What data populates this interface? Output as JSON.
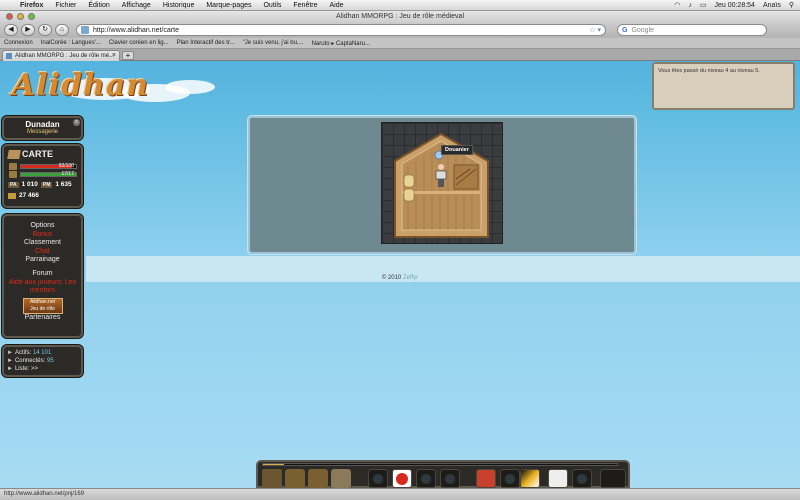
{
  "os_menubar": {
    "brand": "Firefox",
    "items": [
      "Fichier",
      "Édition",
      "Affichage",
      "Historique",
      "Marque-pages",
      "Outils",
      "Fenêtre",
      "Aide"
    ],
    "clock": "Jeu 00:28:54",
    "user": "Anaïs"
  },
  "window": {
    "title": "Alidhan MMORPG : Jeu de rôle médieval"
  },
  "toolbar": {
    "url": "http://www.alidhan.net/carte",
    "search_placeholder": "Google"
  },
  "bookmarks": [
    "Connexion",
    "InalCorée : Langues'...",
    "Clavier coréen en lig...",
    "Plan Interactif des tr...",
    "\"Je suis venu, j'ai bu,...",
    "Naruto ▸ CaptaNaru..."
  ],
  "tab": {
    "label": "Alidhan MMORPG : Jeu de rôle mé..."
  },
  "logo": "Alidhan",
  "notification": "Vous êtes passé du niveau 4 au niveau 5.",
  "user_panel": {
    "name": "Dunadan",
    "messages": "Messagerie"
  },
  "carte": {
    "title": "CARTE",
    "hp": {
      "label": "92/100",
      "fraction": 0.92,
      "color": "#d62a1f"
    },
    "mp": {
      "label": "17/17",
      "fraction": 1.0,
      "color": "#3aa13a"
    },
    "pa_label": "PA",
    "pa": "1 010",
    "pm_label": "PM",
    "pm": "1 635",
    "gold": "27 466"
  },
  "menu": {
    "options": "Options",
    "bonus": "Bonus",
    "classement": "Classement",
    "chat": "Chat",
    "parrainage": "Parrainage",
    "forum": "Forum",
    "aide": "Aide aux joueurs: Les mentors",
    "banner_title": "Alidhan.net",
    "banner_sub": "Jeu de rôle",
    "partenaires": "Partenaires"
  },
  "online": {
    "actifs_label": "Actifs:",
    "actifs": "14 101",
    "connectes_label": "Connectés:",
    "connectes": "95",
    "liste_label": "Liste:",
    "liste": ">>"
  },
  "map": {
    "npc_name": "Douanier"
  },
  "footer": {
    "copyright": "© 2010",
    "author": "Zeffyr"
  },
  "action_bar": {
    "xp_fraction": 0.06
  },
  "statusbar": "http://www.alidhan.net/pnj/169"
}
